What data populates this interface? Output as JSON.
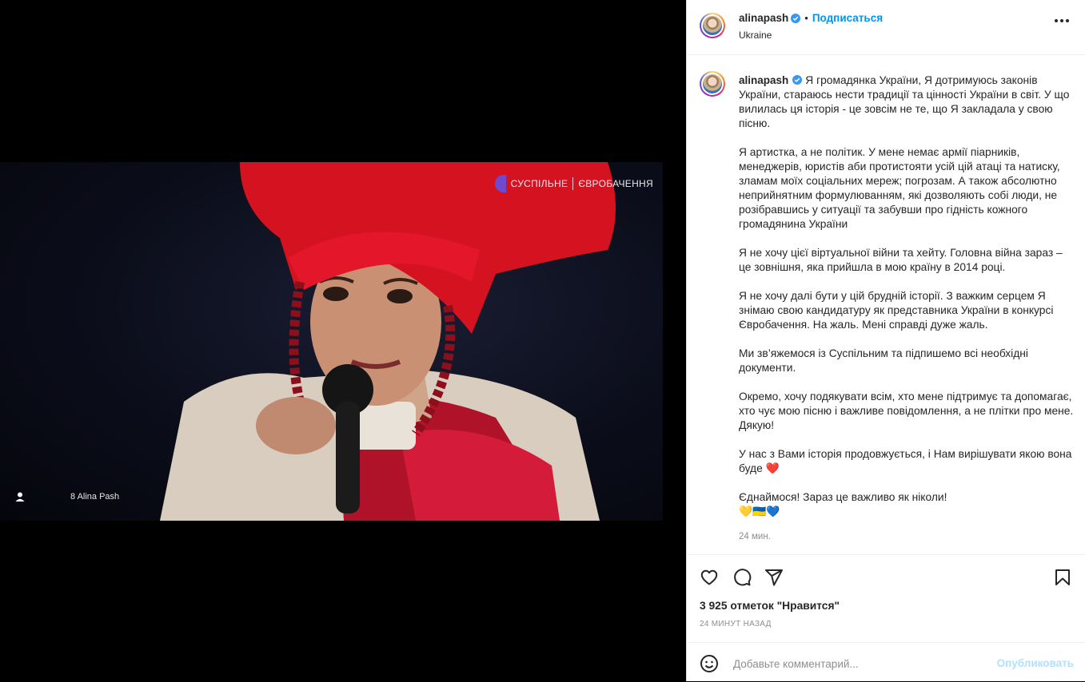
{
  "post": {
    "username": "alinapash",
    "follow_label": "Подписаться",
    "location": "Ukraine",
    "media": {
      "watermark_left": "СУСПІЛЬНЕ",
      "watermark_right": "ЄВРОБАЧЕННЯ",
      "tag_label": "8 Alina Pash"
    },
    "caption": {
      "paragraphs": [
        "Я громадянка України, Я дотримуюсь законів України, стараюсь нести традиції та цінності України в світ. У що вилилась ця історія - це зовсім не те, що Я закладала у свою пісню.",
        "Я артистка, а не політик. У мене немає армії піарників, менеджерів, юристів аби протистояти усій цій атаці та натиску, зламам моїх соціальних мереж; погрозам. А також абсолютно неприйнятним формулюванням, які дозволяють собі люди, не розібравшись у ситуації та забувши про гідність кожного громадянина України",
        "Я не хочу цієї віртуальної війни та хейту. Головна війна зараз – це зовнішня, яка прийшла в мою країну в 2014 році.",
        "Я не хочу далі бути у цій брудній історії. З важким серцем Я знімаю свою кандидатуру як представника України в конкурсі Євробачення. На жаль. Мені справді дуже жаль.",
        "Ми зв’яжемося із Суспільним та підпишемо всі необхідні документи.",
        "Окремо, хочу подякувати всім, хто мене підтримує та допомагає, хто чує мою пісню і важливе повідомлення, а не плітки про мене. Дякую!",
        "У нас з Вами історія продовжується, і Нам вирішувати якою вона буде",
        "Єднаймося! Зараз це важливо як ніколи!"
      ],
      "heart_emoji": "❤️",
      "closing_emoji": "💛🇺🇦💙",
      "time": "24 мин."
    },
    "likes_text": "3 925 отметок \"Нравится\"",
    "posted_ago": "24 МИНУТ НАЗАД",
    "comment": {
      "placeholder": "Добавьте комментарий...",
      "value": "",
      "publish_label": "Опубликовать"
    }
  },
  "icons": [
    "person-tag-icon",
    "verified-badge-icon",
    "more-options-icon",
    "heart-icon",
    "comment-icon",
    "share-icon",
    "bookmark-icon",
    "emoji-icon"
  ],
  "colors": {
    "accent": "#0095f6",
    "publish_disabled": "#b2dffc",
    "verified": "#3897f0",
    "text": "#262626",
    "muted": "#8e8e8e",
    "heart": "#e0245e"
  }
}
